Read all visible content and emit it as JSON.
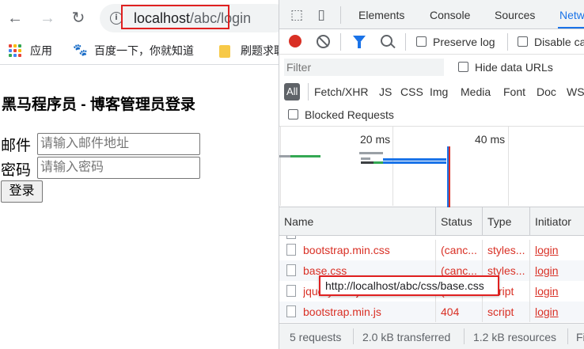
{
  "browser": {
    "back_icon": "←",
    "forward_icon": "→",
    "reload_icon": "↻",
    "url_host": "localhost",
    "url_path": "/abc/login"
  },
  "bookmarks": [
    {
      "label": "应用"
    },
    {
      "label": "百度一下，你就知道"
    },
    {
      "label": "刷题求职"
    }
  ],
  "page": {
    "title": "黑马程序员 - 博客管理员登录",
    "email_label": "邮件",
    "email_placeholder": "请输入邮件地址",
    "password_label": "密码",
    "password_placeholder": "请输入密码",
    "login_button": "登录"
  },
  "devtools": {
    "tabs": [
      "Elements",
      "Console",
      "Sources",
      "Network"
    ],
    "active_tab": "Network",
    "preserve_log": "Preserve log",
    "disable_cache": "Disable cache",
    "filter_placeholder": "Filter",
    "hide_data_urls": "Hide data URLs",
    "type_filters": [
      "All",
      "Fetch/XHR",
      "JS",
      "CSS",
      "Img",
      "Media",
      "Font",
      "Doc",
      "WS"
    ],
    "blocked_requests": "Blocked Requests",
    "timeline_labels": [
      "20 ms",
      "40 ms"
    ],
    "columns": [
      "Name",
      "Status",
      "Type",
      "Initiator"
    ],
    "rows": [
      {
        "name": "bootstrap.min.css",
        "status": "(canc...",
        "type": "styles...",
        "initiator": "login"
      },
      {
        "name": "base.css",
        "status": "(canc...",
        "type": "styles...",
        "initiator": "login"
      },
      {
        "name": "jquery.min.js",
        "status": "(canc...",
        "type": "script",
        "initiator": "login"
      },
      {
        "name": "bootstrap.min.js",
        "status": "404",
        "type": "script",
        "initiator": "login"
      }
    ],
    "tooltip": "http://localhost/abc/css/base.css",
    "status_bar": [
      "5 requests",
      "2.0 kB transferred",
      "1.2 kB resources",
      "Finish"
    ]
  },
  "colors": {
    "error_red": "#d93025",
    "accent_blue": "#1a73e8",
    "highlight_red": "#e02020"
  }
}
